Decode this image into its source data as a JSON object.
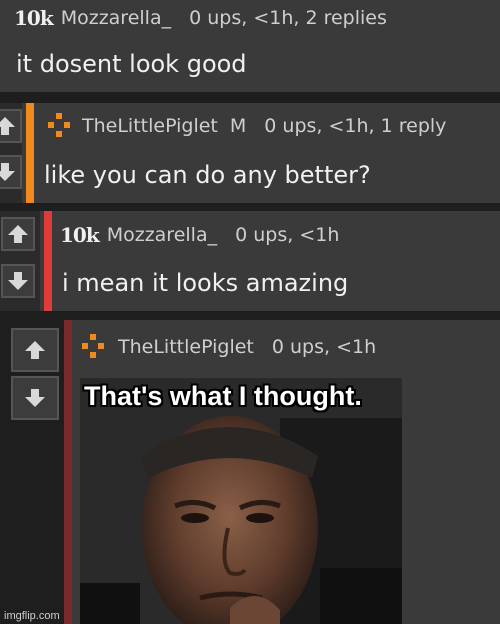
{
  "comments": [
    {
      "badge": "10k",
      "username": "Mozzarella_",
      "meta": "0 ups, <1h, 2 replies",
      "text": "it dosent look good"
    },
    {
      "username": "TheLittlePiglet",
      "mod_tag": "M",
      "meta": "0 ups, <1h, 1 reply",
      "text": "like you can do any better?",
      "bar_color": "#f08a1c"
    },
    {
      "badge": "10k",
      "username": "Mozzarella_",
      "meta": "0 ups, <1h",
      "text": "i mean it looks amazing",
      "bar_color": "#e03a3a"
    },
    {
      "username": "TheLittlePiglet",
      "meta": "0 ups, <1h",
      "bar_color": "#7a2a2a",
      "meme": {
        "caption": "That's what I thought."
      }
    }
  ],
  "watermark": "imgflip.com"
}
